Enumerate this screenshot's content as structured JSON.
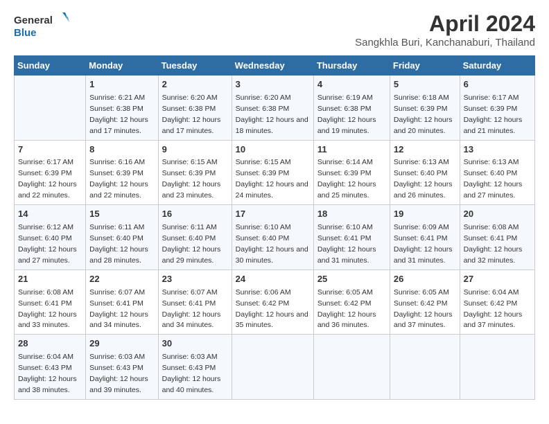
{
  "logo": {
    "text_general": "General",
    "text_blue": "Blue"
  },
  "title": "April 2024",
  "subtitle": "Sangkhla Buri, Kanchanaburi, Thailand",
  "headers": [
    "Sunday",
    "Monday",
    "Tuesday",
    "Wednesday",
    "Thursday",
    "Friday",
    "Saturday"
  ],
  "weeks": [
    [
      {
        "day": "",
        "sunrise": "",
        "sunset": "",
        "daylight": ""
      },
      {
        "day": "1",
        "sunrise": "Sunrise: 6:21 AM",
        "sunset": "Sunset: 6:38 PM",
        "daylight": "Daylight: 12 hours and 17 minutes."
      },
      {
        "day": "2",
        "sunrise": "Sunrise: 6:20 AM",
        "sunset": "Sunset: 6:38 PM",
        "daylight": "Daylight: 12 hours and 17 minutes."
      },
      {
        "day": "3",
        "sunrise": "Sunrise: 6:20 AM",
        "sunset": "Sunset: 6:38 PM",
        "daylight": "Daylight: 12 hours and 18 minutes."
      },
      {
        "day": "4",
        "sunrise": "Sunrise: 6:19 AM",
        "sunset": "Sunset: 6:38 PM",
        "daylight": "Daylight: 12 hours and 19 minutes."
      },
      {
        "day": "5",
        "sunrise": "Sunrise: 6:18 AM",
        "sunset": "Sunset: 6:39 PM",
        "daylight": "Daylight: 12 hours and 20 minutes."
      },
      {
        "day": "6",
        "sunrise": "Sunrise: 6:17 AM",
        "sunset": "Sunset: 6:39 PM",
        "daylight": "Daylight: 12 hours and 21 minutes."
      }
    ],
    [
      {
        "day": "7",
        "sunrise": "Sunrise: 6:17 AM",
        "sunset": "Sunset: 6:39 PM",
        "daylight": "Daylight: 12 hours and 22 minutes."
      },
      {
        "day": "8",
        "sunrise": "Sunrise: 6:16 AM",
        "sunset": "Sunset: 6:39 PM",
        "daylight": "Daylight: 12 hours and 22 minutes."
      },
      {
        "day": "9",
        "sunrise": "Sunrise: 6:15 AM",
        "sunset": "Sunset: 6:39 PM",
        "daylight": "Daylight: 12 hours and 23 minutes."
      },
      {
        "day": "10",
        "sunrise": "Sunrise: 6:15 AM",
        "sunset": "Sunset: 6:39 PM",
        "daylight": "Daylight: 12 hours and 24 minutes."
      },
      {
        "day": "11",
        "sunrise": "Sunrise: 6:14 AM",
        "sunset": "Sunset: 6:39 PM",
        "daylight": "Daylight: 12 hours and 25 minutes."
      },
      {
        "day": "12",
        "sunrise": "Sunrise: 6:13 AM",
        "sunset": "Sunset: 6:40 PM",
        "daylight": "Daylight: 12 hours and 26 minutes."
      },
      {
        "day": "13",
        "sunrise": "Sunrise: 6:13 AM",
        "sunset": "Sunset: 6:40 PM",
        "daylight": "Daylight: 12 hours and 27 minutes."
      }
    ],
    [
      {
        "day": "14",
        "sunrise": "Sunrise: 6:12 AM",
        "sunset": "Sunset: 6:40 PM",
        "daylight": "Daylight: 12 hours and 27 minutes."
      },
      {
        "day": "15",
        "sunrise": "Sunrise: 6:11 AM",
        "sunset": "Sunset: 6:40 PM",
        "daylight": "Daylight: 12 hours and 28 minutes."
      },
      {
        "day": "16",
        "sunrise": "Sunrise: 6:11 AM",
        "sunset": "Sunset: 6:40 PM",
        "daylight": "Daylight: 12 hours and 29 minutes."
      },
      {
        "day": "17",
        "sunrise": "Sunrise: 6:10 AM",
        "sunset": "Sunset: 6:40 PM",
        "daylight": "Daylight: 12 hours and 30 minutes."
      },
      {
        "day": "18",
        "sunrise": "Sunrise: 6:10 AM",
        "sunset": "Sunset: 6:41 PM",
        "daylight": "Daylight: 12 hours and 31 minutes."
      },
      {
        "day": "19",
        "sunrise": "Sunrise: 6:09 AM",
        "sunset": "Sunset: 6:41 PM",
        "daylight": "Daylight: 12 hours and 31 minutes."
      },
      {
        "day": "20",
        "sunrise": "Sunrise: 6:08 AM",
        "sunset": "Sunset: 6:41 PM",
        "daylight": "Daylight: 12 hours and 32 minutes."
      }
    ],
    [
      {
        "day": "21",
        "sunrise": "Sunrise: 6:08 AM",
        "sunset": "Sunset: 6:41 PM",
        "daylight": "Daylight: 12 hours and 33 minutes."
      },
      {
        "day": "22",
        "sunrise": "Sunrise: 6:07 AM",
        "sunset": "Sunset: 6:41 PM",
        "daylight": "Daylight: 12 hours and 34 minutes."
      },
      {
        "day": "23",
        "sunrise": "Sunrise: 6:07 AM",
        "sunset": "Sunset: 6:41 PM",
        "daylight": "Daylight: 12 hours and 34 minutes."
      },
      {
        "day": "24",
        "sunrise": "Sunrise: 6:06 AM",
        "sunset": "Sunset: 6:42 PM",
        "daylight": "Daylight: 12 hours and 35 minutes."
      },
      {
        "day": "25",
        "sunrise": "Sunrise: 6:05 AM",
        "sunset": "Sunset: 6:42 PM",
        "daylight": "Daylight: 12 hours and 36 minutes."
      },
      {
        "day": "26",
        "sunrise": "Sunrise: 6:05 AM",
        "sunset": "Sunset: 6:42 PM",
        "daylight": "Daylight: 12 hours and 37 minutes."
      },
      {
        "day": "27",
        "sunrise": "Sunrise: 6:04 AM",
        "sunset": "Sunset: 6:42 PM",
        "daylight": "Daylight: 12 hours and 37 minutes."
      }
    ],
    [
      {
        "day": "28",
        "sunrise": "Sunrise: 6:04 AM",
        "sunset": "Sunset: 6:43 PM",
        "daylight": "Daylight: 12 hours and 38 minutes."
      },
      {
        "day": "29",
        "sunrise": "Sunrise: 6:03 AM",
        "sunset": "Sunset: 6:43 PM",
        "daylight": "Daylight: 12 hours and 39 minutes."
      },
      {
        "day": "30",
        "sunrise": "Sunrise: 6:03 AM",
        "sunset": "Sunset: 6:43 PM",
        "daylight": "Daylight: 12 hours and 40 minutes."
      },
      {
        "day": "",
        "sunrise": "",
        "sunset": "",
        "daylight": ""
      },
      {
        "day": "",
        "sunrise": "",
        "sunset": "",
        "daylight": ""
      },
      {
        "day": "",
        "sunrise": "",
        "sunset": "",
        "daylight": ""
      },
      {
        "day": "",
        "sunrise": "",
        "sunset": "",
        "daylight": ""
      }
    ]
  ]
}
